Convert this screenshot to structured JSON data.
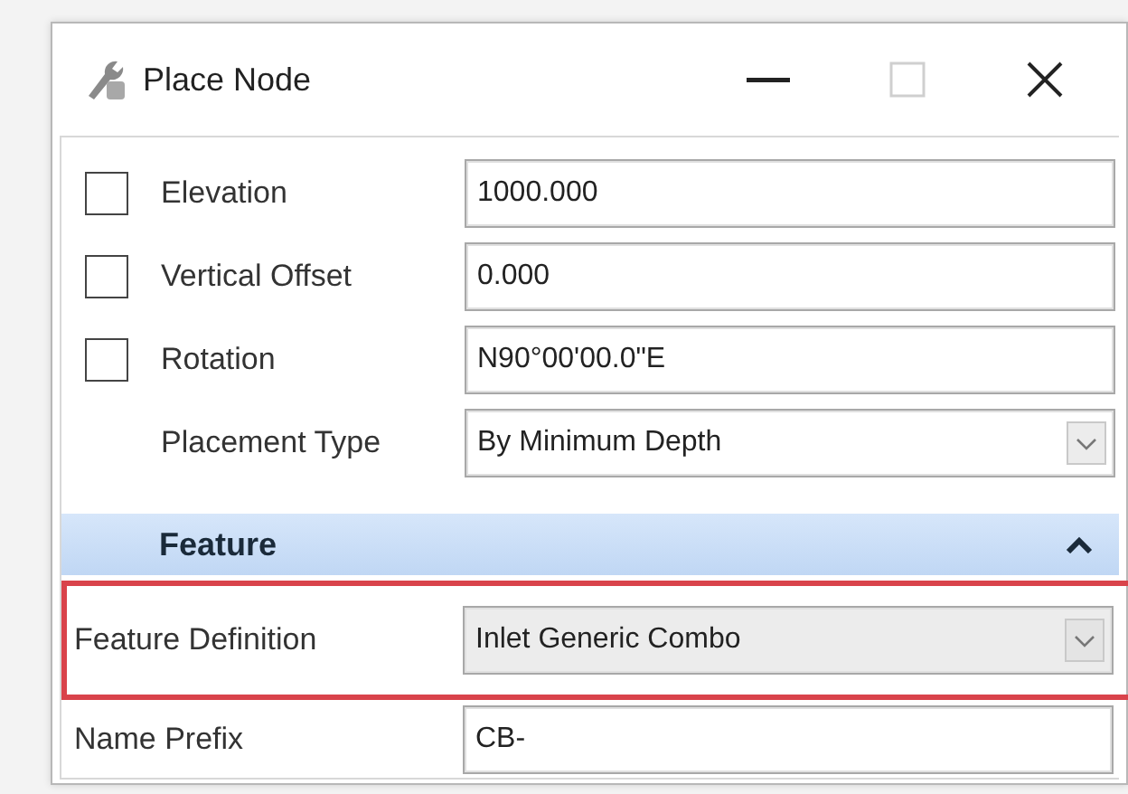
{
  "window": {
    "title": "Place Node"
  },
  "parameters": [
    {
      "kind": "check-text",
      "label": "Elevation",
      "checked": false,
      "value": "1000.000"
    },
    {
      "kind": "check-text",
      "label": "Vertical Offset",
      "checked": false,
      "value": "0.000"
    },
    {
      "kind": "check-text",
      "label": "Rotation",
      "checked": false,
      "value": "N90°00'00.0\"E"
    },
    {
      "kind": "dropdown",
      "label": "Placement Type",
      "value": "By Minimum Depth"
    }
  ],
  "section": {
    "title": "Feature",
    "expanded": true,
    "fields": [
      {
        "kind": "dropdown",
        "label": "Feature Definition",
        "value": "Inlet Generic Combo",
        "highlighted": true
      },
      {
        "kind": "text",
        "label": "Name Prefix",
        "value": "CB-",
        "highlighted": false
      }
    ]
  }
}
